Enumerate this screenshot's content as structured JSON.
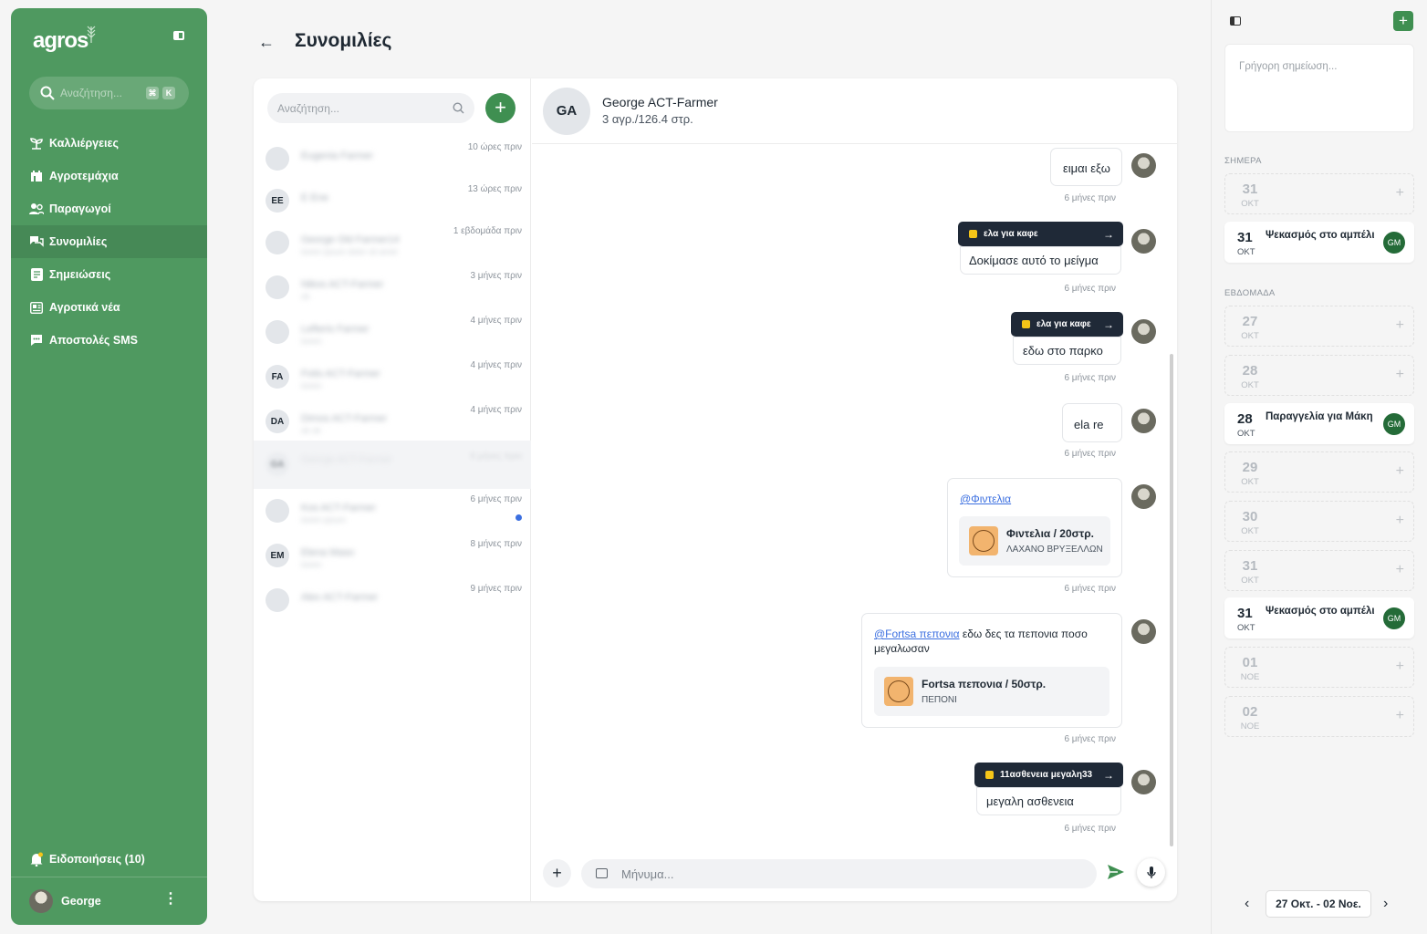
{
  "sidebar": {
    "logo": "agros",
    "search_placeholder": "Αναζήτηση...",
    "shortcut_mod": "⌘",
    "shortcut_key": "K",
    "items": [
      {
        "label": "Καλλιέργειες",
        "icon": "sprout-icon"
      },
      {
        "label": "Αγροτεμάχια",
        "icon": "field-icon"
      },
      {
        "label": "Παραγωγοί",
        "icon": "users-icon"
      },
      {
        "label": "Συνομιλίες",
        "icon": "chat-icon",
        "active": true
      },
      {
        "label": "Σημειώσεις",
        "icon": "note-icon"
      },
      {
        "label": "Αγροτικά νέα",
        "icon": "news-icon"
      },
      {
        "label": "Αποστολές SMS",
        "icon": "sms-icon"
      }
    ],
    "notifications_label": "Ειδοποιήσεις (10)",
    "user_name": "George"
  },
  "header": {
    "title": "Συνομιλίες"
  },
  "conversations": {
    "search_placeholder": "Αναζήτηση...",
    "items": [
      {
        "initials": "",
        "name": "Eugenia Farmer",
        "preview": "",
        "time": "10 ώρες πριν"
      },
      {
        "initials": "EE",
        "name": "E Ene",
        "preview": "",
        "time": "13 ώρες πριν"
      },
      {
        "initials": "",
        "name": "George Old Farmer14",
        "preview": "lorem ipsum dolor sit amet",
        "time": "1 εβδομάδα πριν"
      },
      {
        "initials": "",
        "name": "Nikos ACT-Farmer",
        "preview": "ok",
        "time": "3 μήνες πριν"
      },
      {
        "initials": "",
        "name": "Lefteris Farmer",
        "preview": "lorem",
        "time": "4 μήνες πριν"
      },
      {
        "initials": "FA",
        "name": "Fotis ACT-Farmer",
        "preview": "lorem",
        "time": "4 μήνες πριν"
      },
      {
        "initials": "DA",
        "name": "Dimos ACT-Farmer",
        "preview": "ok ok",
        "time": "4 μήνες πριν"
      },
      {
        "initials": "GA",
        "name": "George ACT-Farmer",
        "preview": "",
        "time": "6 μήνες πριν"
      },
      {
        "initials": "",
        "name": "Kos ACT-Farmer",
        "preview": "lorem ipsum",
        "time": "6 μήνες πριν",
        "unread": true
      },
      {
        "initials": "EM",
        "name": "Elena Maso",
        "preview": "lorem",
        "time": "8 μήνες πριν"
      },
      {
        "initials": "",
        "name": "Alex ACT-Farmer",
        "preview": "",
        "time": "9 μήνες πριν"
      }
    ]
  },
  "chat": {
    "initials": "GA",
    "name": "George ACT-Farmer",
    "subtitle": "3 αγρ./126.4 στρ.",
    "messages": [
      {
        "text": "ειμαι εξω",
        "time": "6 μήνες πριν"
      },
      {
        "note": "ελα για καφε",
        "text": "Δοκίμασε αυτό το μείγμα",
        "time": "6 μήνες πριν"
      },
      {
        "note": "ελα για καφε",
        "text": "εδω στο παρκο",
        "time": "6 μήνες πριν"
      },
      {
        "text": "ela re",
        "time": "6 μήνες πριν"
      },
      {
        "mention": "@Φιντελια",
        "card_title": "Φιντελια / 20στρ.",
        "card_sub": "ΛΑΧΑΝΟ ΒΡΥΞΕΛΛΩΝ",
        "time": "6 μήνες πριν"
      },
      {
        "mention": "@Fortsa πεπονια",
        "text": " εδω δες τα πεπονια ποσο μεγαλωσαν",
        "card_title": "Fortsa πεπονια / 50στρ.",
        "card_sub": "ΠΕΠΟΝΙ",
        "time": "6 μήνες πριν"
      },
      {
        "note": "11ασθενεια μεγαλη33",
        "text": "μεγαλη ασθενεια",
        "time": "6 μήνες πριν"
      }
    ],
    "composer_placeholder": "Μήνυμα..."
  },
  "right": {
    "quick_note_placeholder": "Γρήγορη σημείωση...",
    "today_label": "ΣΗΜΕΡΑ",
    "week_label": "ΕΒΔΟΜΑΔΑ",
    "today": [
      {
        "day": "31",
        "month": "ΟΚΤ"
      },
      {
        "day": "31",
        "month": "ΟΚΤ",
        "title": "Ψεκασμός στο αμπέλι",
        "badge": "GM"
      }
    ],
    "week": [
      {
        "day": "27",
        "month": "ΟΚΤ"
      },
      {
        "day": "28",
        "month": "ΟΚΤ"
      },
      {
        "day": "28",
        "month": "ΟΚΤ",
        "title": "Παραγγελία για Μάκη",
        "badge": "GM"
      },
      {
        "day": "29",
        "month": "ΟΚΤ"
      },
      {
        "day": "30",
        "month": "ΟΚΤ"
      },
      {
        "day": "31",
        "month": "ΟΚΤ"
      },
      {
        "day": "31",
        "month": "ΟΚΤ",
        "title": "Ψεκασμός στο αμπέλι",
        "badge": "GM"
      },
      {
        "day": "01",
        "month": "ΝΟΕ"
      },
      {
        "day": "02",
        "month": "ΝΟΕ"
      }
    ],
    "range_label": "27 Οκτ. - 02 Νοε."
  },
  "colors": {
    "sidebar": "#4f9960",
    "accent": "#3f8f51",
    "note_tag": "#1f2937",
    "unread": "#3b6fe0"
  }
}
